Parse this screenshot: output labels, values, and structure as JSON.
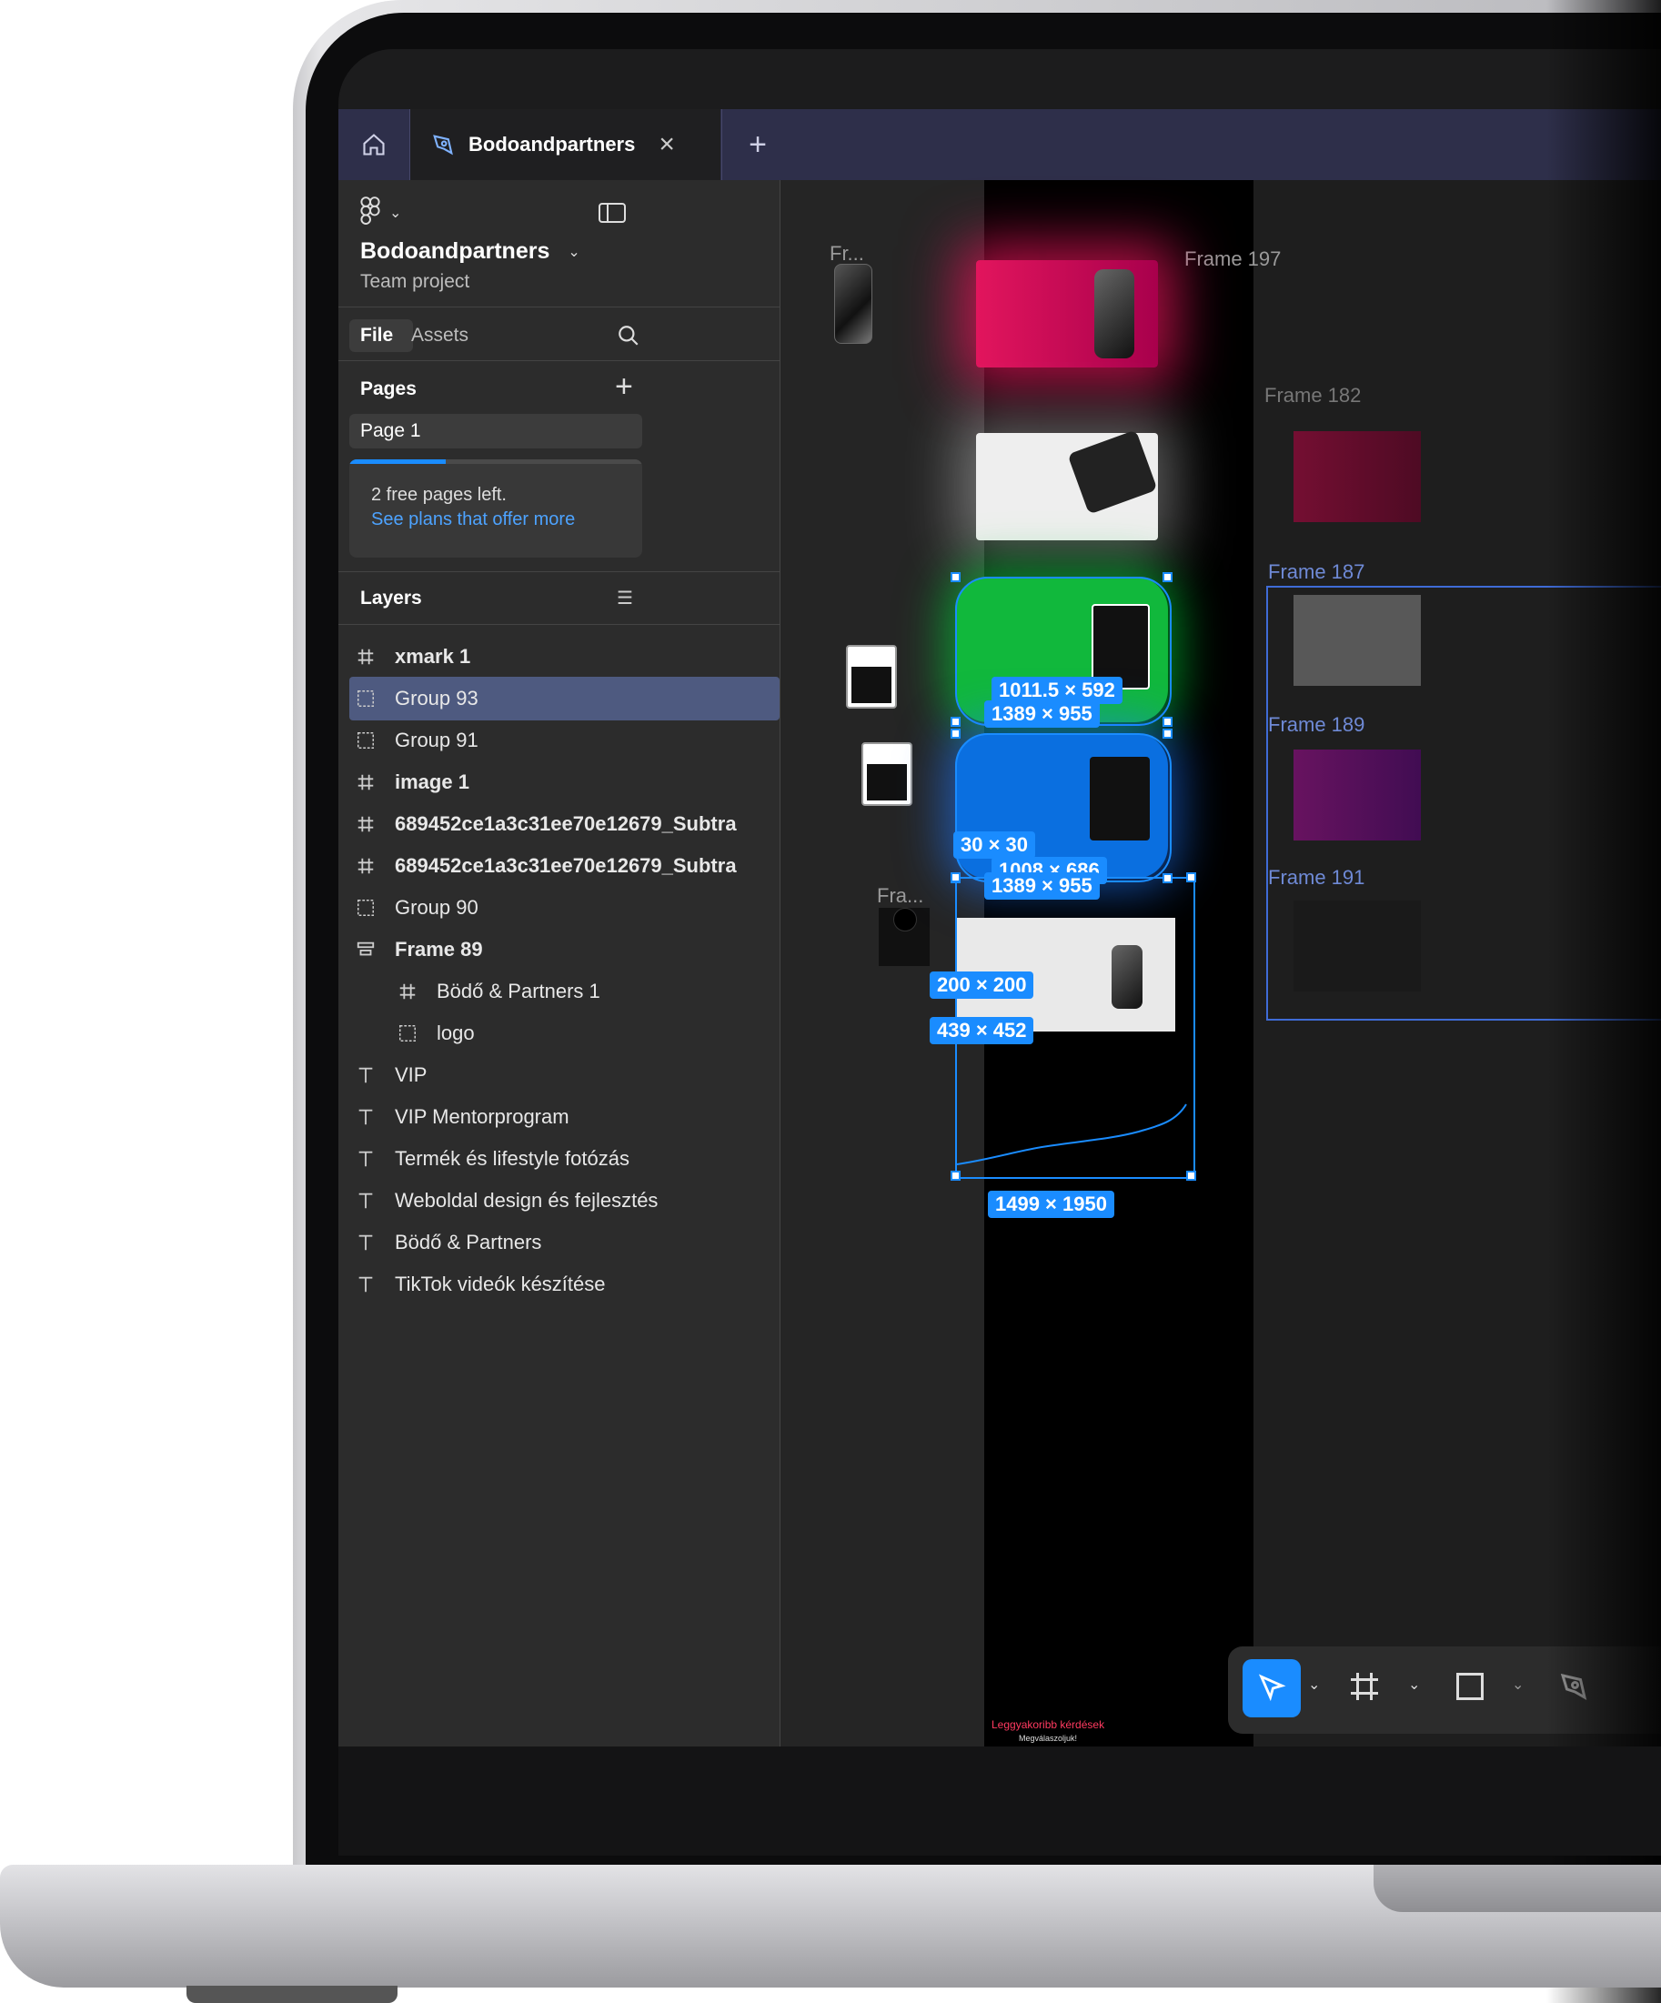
{
  "app": {
    "tabs": {
      "home_icon": "home-icon",
      "active_tab": "Bodoandpartners",
      "add_icon": "plus-icon"
    },
    "sidebar": {
      "project_name": "Bodoandpartners",
      "project_sub": "Team project",
      "tab_file": "File",
      "tab_assets": "Assets",
      "pages_title": "Pages",
      "page_1": "Page 1",
      "upsell_text": "2 free pages left.",
      "upsell_link": "See plans that offer more",
      "upsell_progress": 0.33,
      "layers_title": "Layers",
      "layers": [
        {
          "name": "xmark 1",
          "icon": "frame-icon",
          "bold": true
        },
        {
          "name": "Group 93",
          "icon": "group-icon",
          "selected": true
        },
        {
          "name": "Group 91",
          "icon": "group-icon"
        },
        {
          "name": "image 1",
          "icon": "frame-icon",
          "bold": true
        },
        {
          "name": "689452ce1a3c31ee70e12679_Subtra",
          "icon": "frame-icon",
          "bold": true
        },
        {
          "name": "689452ce1a3c31ee70e12679_Subtra",
          "icon": "frame-icon",
          "bold": true
        },
        {
          "name": "Group 90",
          "icon": "group-icon"
        },
        {
          "name": "Frame 89",
          "icon": "autolayout-icon",
          "bold": true
        },
        {
          "name": "Bödő & Partners 1",
          "icon": "frame-icon",
          "indent": true
        },
        {
          "name": "logo",
          "icon": "group-icon",
          "indent": true
        },
        {
          "name": "VIP",
          "icon": "text-icon"
        },
        {
          "name": "VIP Mentorprogram",
          "icon": "text-icon"
        },
        {
          "name": "Termék és lifestyle fotózás",
          "icon": "text-icon"
        },
        {
          "name": "Weboldal design és fejlesztés",
          "icon": "text-icon"
        },
        {
          "name": "Bödő & Partners",
          "icon": "text-icon"
        },
        {
          "name": "TikTok videók készítése",
          "icon": "text-icon"
        }
      ]
    },
    "canvas": {
      "labels": {
        "fr1": "Fr...",
        "fra": "Fra...",
        "f197": "Frame 197",
        "f182": "Frame 182",
        "f187": "Frame 187",
        "f189": "Frame 189",
        "f191": "Frame 191"
      },
      "dims": {
        "d1": "1011.5 × 592",
        "d2": "1389 × 955",
        "d3": "30 × 30",
        "d4": "1008 × 686",
        "d5": "1389 × 955",
        "d6": "200 × 200",
        "d7": "439 × 452",
        "d8": "1499 × 1950"
      },
      "card_text": {
        "faq_title": "Leggyakoribb kérdések",
        "faq_sub": "Megválaszoljuk!"
      }
    },
    "toolbar": {
      "move_tool": "move-icon",
      "frame_tool": "frame-icon",
      "shape_tool": "rectangle-icon",
      "pen_tool": "pen-icon"
    },
    "colors": {
      "accent": "#1a8cff",
      "selection": "#4e5a80",
      "panel": "#2c2c2c",
      "link": "#4da3ff"
    }
  }
}
